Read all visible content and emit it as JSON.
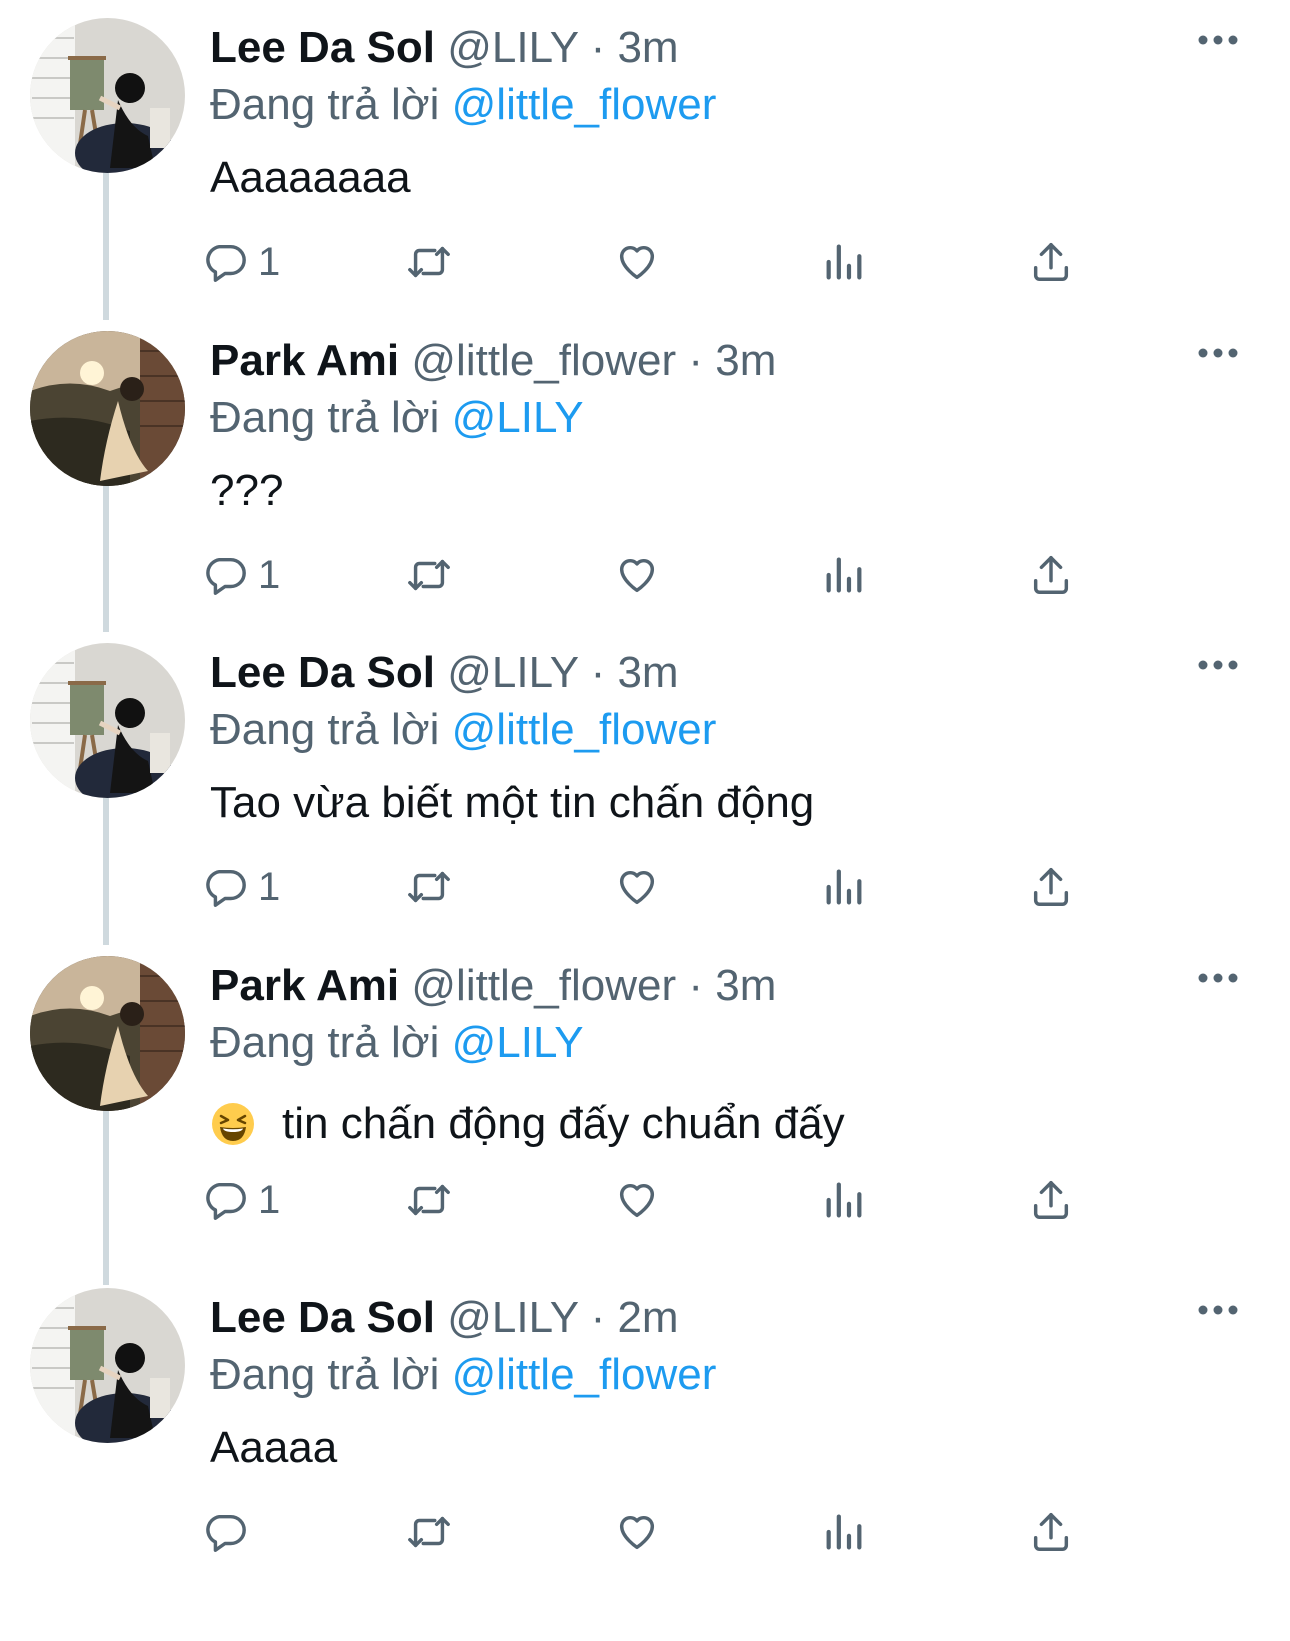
{
  "tweets": [
    {
      "name": "Lee Da Sol",
      "handle": "@LILY",
      "dot": "·",
      "time": "3m",
      "replying_label": "Đang trả lời",
      "replying_to": "@little_flower",
      "text": "Aaaaaaaa",
      "reply_count": "1",
      "avatar": "easel-painter-avatar",
      "emoji": ""
    },
    {
      "name": "Park Ami",
      "handle": "@little_flower",
      "dot": "·",
      "time": "3m",
      "replying_label": "Đang trả lời",
      "replying_to": "@LILY",
      "text": "???",
      "reply_count": "1",
      "avatar": "sunset-window-avatar",
      "emoji": ""
    },
    {
      "name": "Lee Da Sol",
      "handle": "@LILY",
      "dot": "·",
      "time": "3m",
      "replying_label": "Đang trả lời",
      "replying_to": "@little_flower",
      "text": "Tao vừa biết một tin chấn động",
      "reply_count": "1",
      "avatar": "easel-painter-avatar",
      "emoji": ""
    },
    {
      "name": "Park Ami",
      "handle": "@little_flower",
      "dot": "·",
      "time": "3m",
      "replying_label": "Đang trả lời",
      "replying_to": "@LILY",
      "text": "tin chấn động đấy chuẩn đấy",
      "reply_count": "1",
      "avatar": "sunset-window-avatar",
      "emoji": "laughing-face-emoji"
    },
    {
      "name": "Lee Da Sol",
      "handle": "@LILY",
      "dot": "·",
      "time": "2m",
      "replying_label": "Đang trả lời",
      "replying_to": "@little_flower",
      "text": "Aaaaa",
      "reply_count": "",
      "avatar": "easel-painter-avatar",
      "emoji": ""
    }
  ],
  "icons": {
    "reply": "reply-icon",
    "retweet": "retweet-icon",
    "like": "heart-icon",
    "views": "views-icon",
    "share": "share-icon",
    "more": "more-icon"
  },
  "colors": {
    "mention": "#1d9bf0",
    "secondary_text": "#536471",
    "primary_text": "#0f1419",
    "thread_line": "#cfd9de"
  }
}
